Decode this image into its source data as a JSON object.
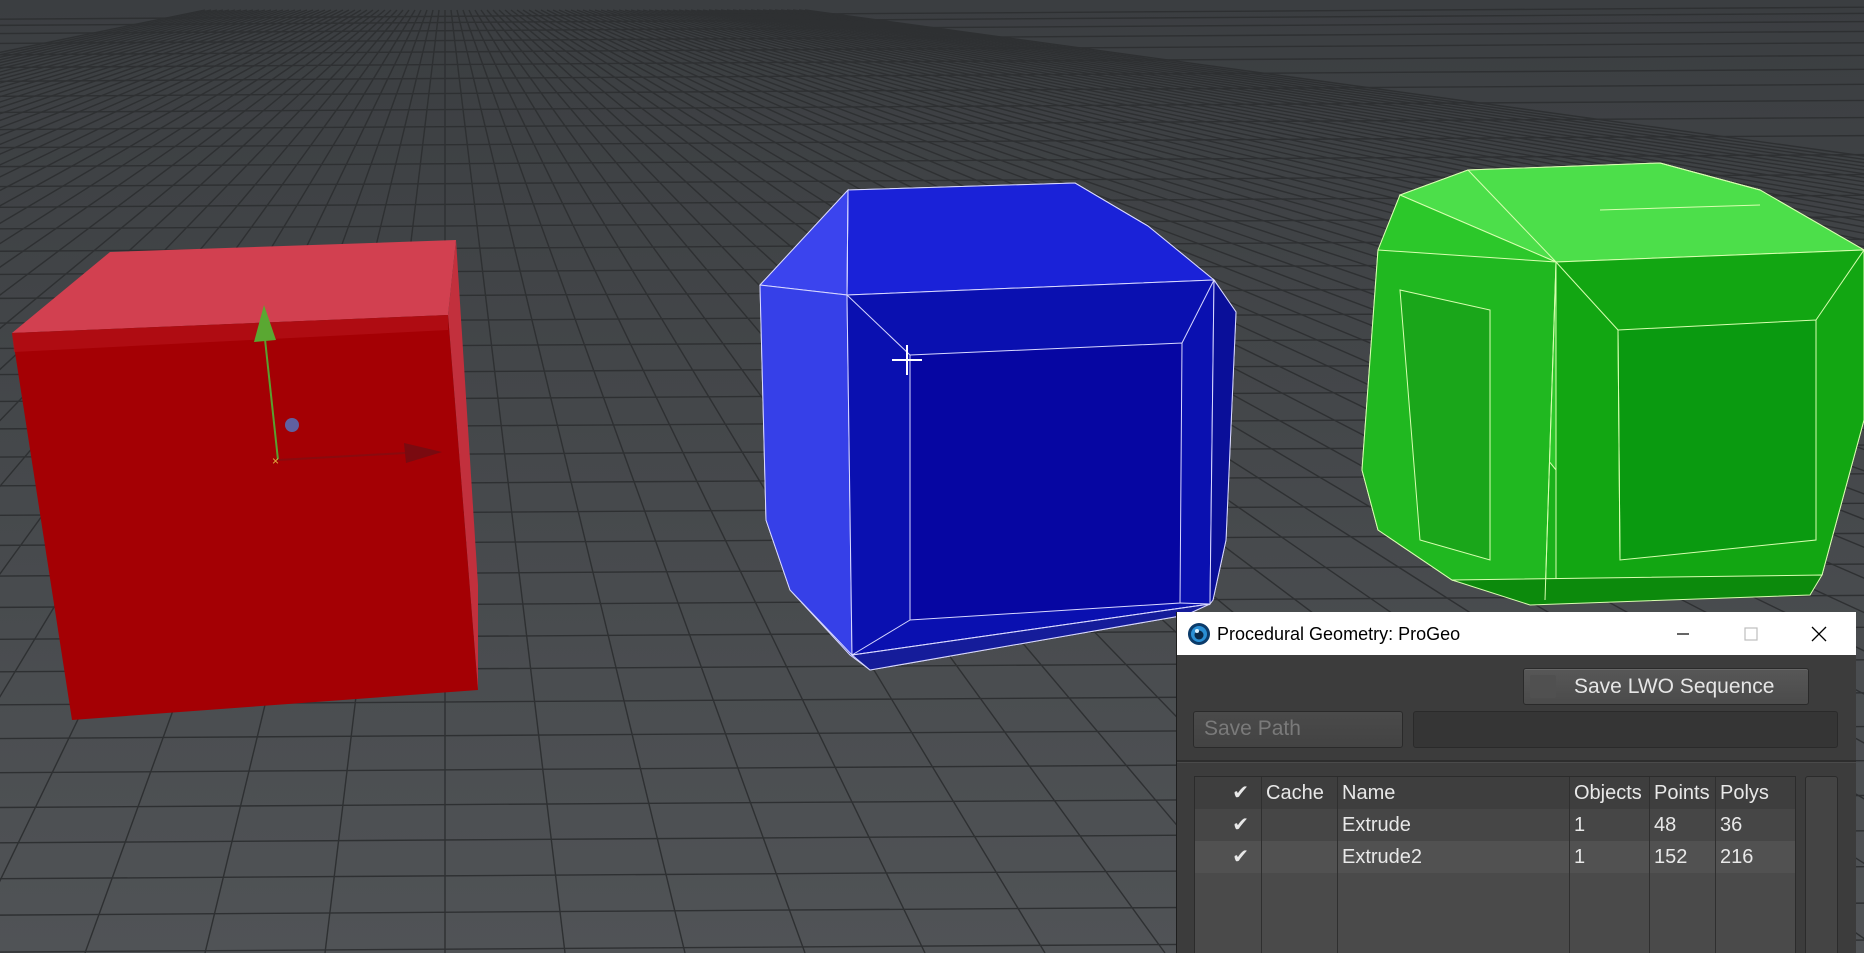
{
  "dialog": {
    "title": "Procedural Geometry: ProGeo",
    "save_sequence_label": "Save LWO Sequence",
    "save_path_label": "Save Path",
    "save_path_value": ""
  },
  "table": {
    "headers": {
      "check": "✔",
      "cache": "Cache",
      "name": "Name",
      "objects": "Objects",
      "points": "Points",
      "polys": "Polys"
    },
    "rows": [
      {
        "check": "✔",
        "cache": "",
        "name": "Extrude",
        "objects": "1",
        "points": "48",
        "polys": "36"
      },
      {
        "check": "✔",
        "cache": "",
        "name": "Extrude2",
        "objects": "1",
        "points": "152",
        "polys": "216"
      }
    ]
  },
  "scene": {
    "objects": [
      {
        "name": "red-cube",
        "color": "#b00000"
      },
      {
        "name": "blue-beveled-cube",
        "color": "#0a14c8"
      },
      {
        "name": "green-beveled-cube",
        "color": "#12b812"
      }
    ]
  },
  "icons": {
    "app": "lightwave-icon",
    "minimize": "minimize-icon",
    "maximize": "maximize-icon",
    "close": "close-icon"
  }
}
